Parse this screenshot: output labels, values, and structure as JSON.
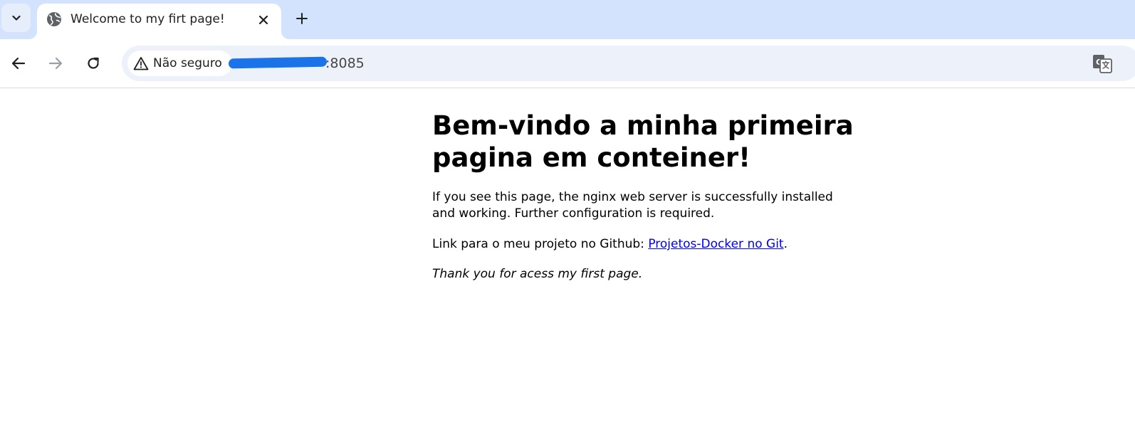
{
  "browser": {
    "tab": {
      "title": "Welcome to my firt page!",
      "favicon": "globe-icon"
    },
    "toolbar": {
      "back_icon": "back-arrow-icon",
      "forward_icon": "forward-arrow-icon",
      "reload_icon": "reload-icon",
      "security_label": "Não seguro",
      "security_icon": "warning-triangle-icon",
      "url_visible": ":8085",
      "translate_icon": "translate-icon"
    },
    "colors": {
      "tabstrip": "#d3e3fd",
      "omnibox": "#edf2fa",
      "link": "#0000ee",
      "redaction": "#1a73e8"
    }
  },
  "page": {
    "heading": "Bem-vindo a minha primeira pagina em conteiner!",
    "intro": "If you see this page, the nginx web server is successfully installed and working. Further configuration is required.",
    "link_prefix": "Link para o meu projeto no Github: ",
    "link_text": "Projetos-Docker no Git",
    "link_suffix": ".",
    "closing": "Thank you for acess my first page."
  }
}
